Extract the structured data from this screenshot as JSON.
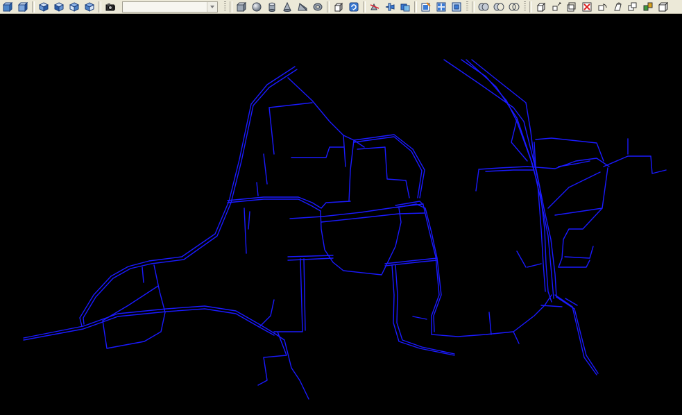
{
  "toolbar": {
    "groups": [
      [
        "view-front-icon",
        "view-iso-icon"
      ],
      [
        "view-se-iso-icon",
        "view-sw-iso-icon",
        "view-ne-iso-icon",
        "view-nw-iso-icon"
      ],
      [
        "camera-icon"
      ],
      [
        "box-icon",
        "sphere-icon",
        "cylinder-icon",
        "cone-icon",
        "wedge-icon",
        "torus-icon"
      ],
      [
        "extrude-icon",
        "revolve-icon"
      ],
      [
        "slice-icon",
        "section-icon",
        "interference-icon"
      ],
      [
        "setup-drawing-icon",
        "setup-view-icon",
        "setup-profile-icon"
      ],
      [
        "union-icon",
        "subtract-icon",
        "intersect-icon"
      ],
      [
        "extrude-faces-icon",
        "move-faces-icon",
        "offset-faces-icon",
        "delete-faces-icon",
        "rotate-faces-icon",
        "taper-faces-icon",
        "copy-faces-icon",
        "color-faces-icon",
        "imprint-icon"
      ]
    ],
    "layer_combo": {
      "value": ""
    }
  },
  "drawing": {
    "line_color": "#1a1aff",
    "background": "#000000"
  }
}
